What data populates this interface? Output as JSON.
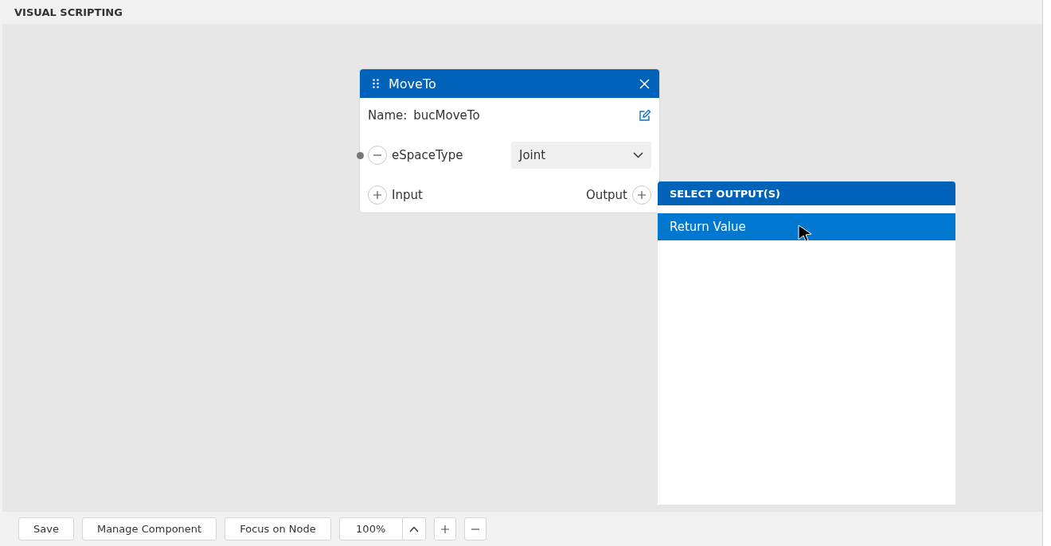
{
  "panel": {
    "title": "VISUAL SCRIPTING"
  },
  "node": {
    "title": "MoveTo",
    "name_label": "Name:",
    "name_value": "bucMoveTo",
    "params": [
      {
        "label": "eSpaceType",
        "value": "Joint",
        "connected": true
      }
    ],
    "input_label": "Input",
    "output_label": "Output"
  },
  "output_menu": {
    "title": "SELECT OUTPUT(S)",
    "items": [
      {
        "label": "Return Value",
        "selected": true
      }
    ]
  },
  "toolbar": {
    "buttons": [
      {
        "label": "Save"
      },
      {
        "label": "Manage Component"
      },
      {
        "label": "Focus on Node"
      }
    ],
    "zoom": "100%"
  }
}
